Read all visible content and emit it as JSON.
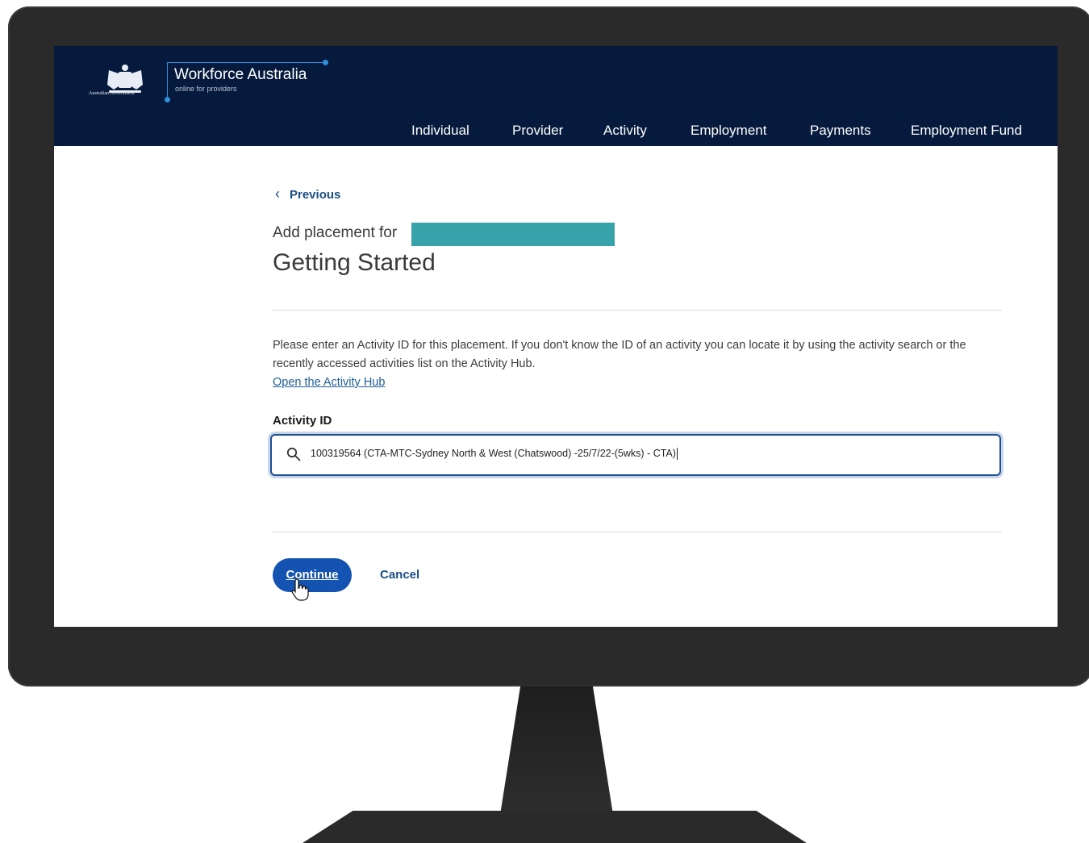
{
  "header": {
    "gov_label": "Australian Government",
    "brand_title": "Workforce Australia",
    "brand_sub": "online for providers",
    "nav": [
      "Individual",
      "Provider",
      "Activity",
      "Employment",
      "Payments",
      "Employment Fund"
    ]
  },
  "page": {
    "previous_label": "Previous",
    "sub_heading": "Add placement for",
    "heading": "Getting Started",
    "instructions": "Please enter an Activity ID for this placement. If you don't know the ID of an activity you can locate it by using the activity search or the recently accessed activities list on the Activity Hub.",
    "hub_link": "Open the Activity Hub",
    "field_label": "Activity ID",
    "field_value": "100319564 (CTA-MTC-Sydney North & West (Chatswood) -25/7/22-(5wks) - CTA)",
    "continue_label": "Continue",
    "cancel_label": "Cancel"
  },
  "colors": {
    "header_bg": "#061a3d",
    "accent": "#1553b3",
    "redaction": "#38a2ab",
    "link": "#1f5f96"
  }
}
